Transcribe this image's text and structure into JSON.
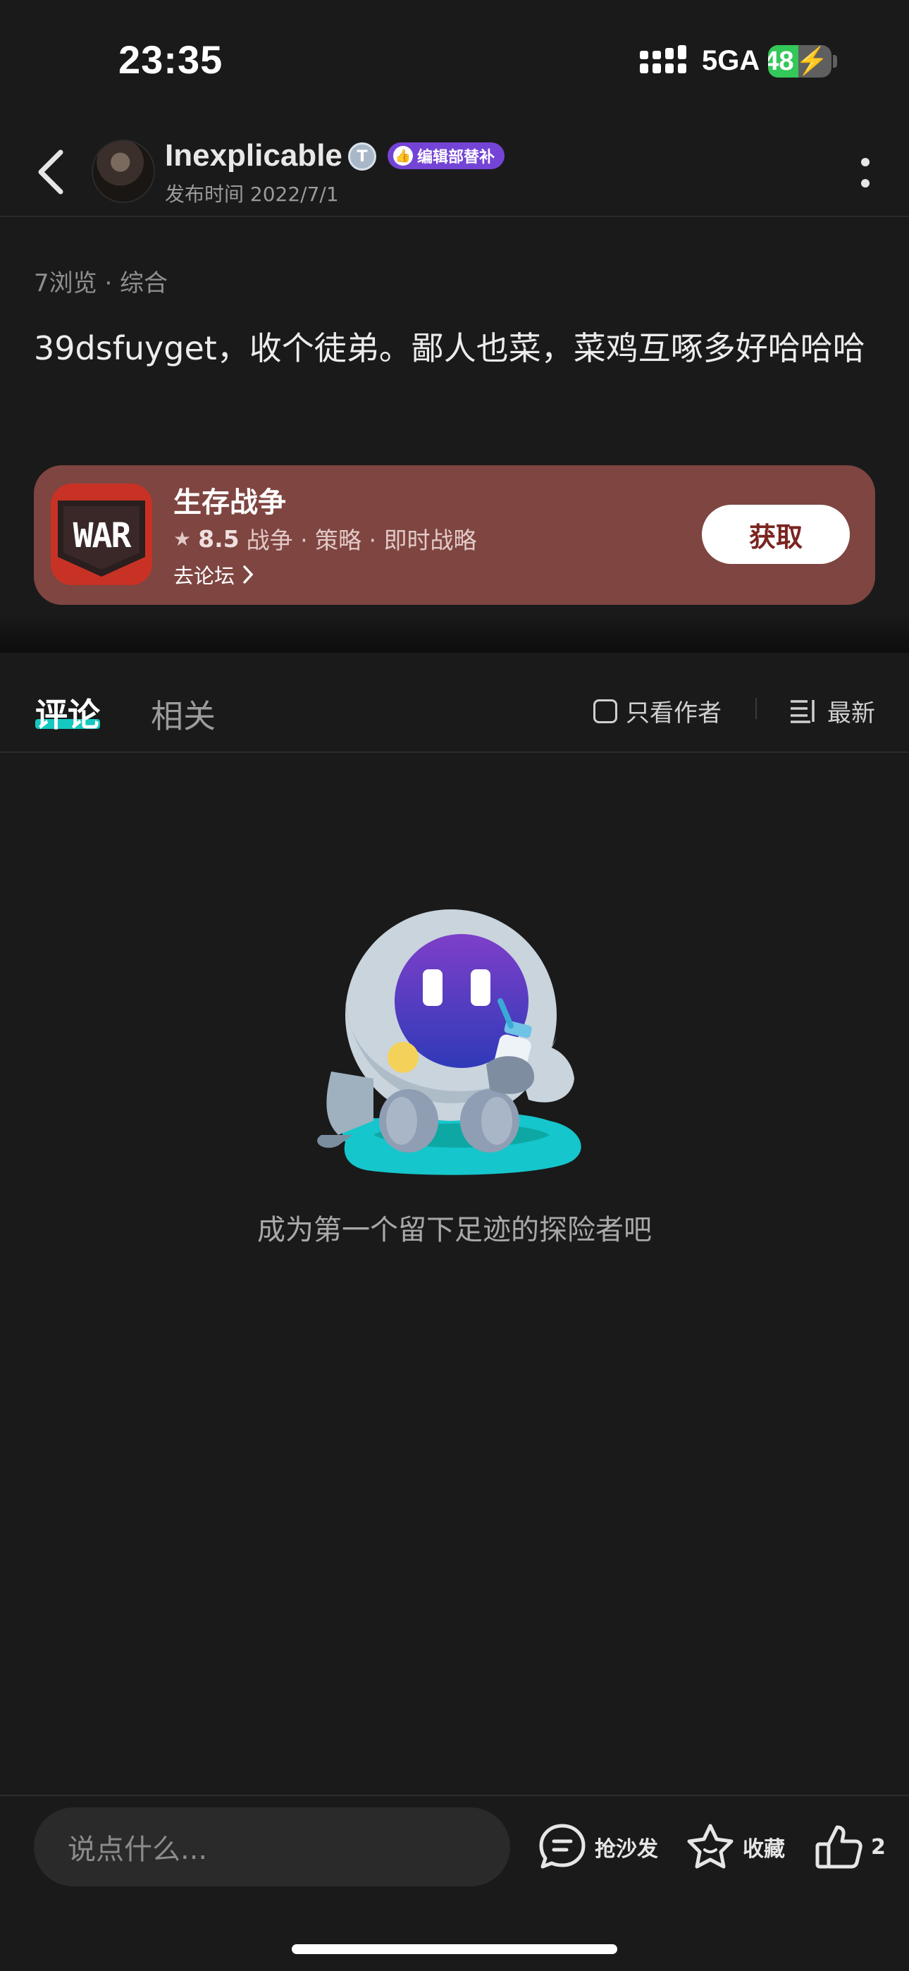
{
  "status_bar": {
    "time": "23:35",
    "network": "5GA",
    "battery": "48",
    "battery_level_pct": 48
  },
  "header": {
    "username": "Inexplicable",
    "level_badge": "T",
    "role_badge": "编辑部替补",
    "publish_time": "发布时间 2022/7/1"
  },
  "post": {
    "meta": "7浏览 · 综合",
    "text": "39dsfuyget，收个徒弟。鄙人也菜，菜鸡互啄多好哈哈哈"
  },
  "game_card": {
    "name": "生存战争",
    "rating": "8.5",
    "tags": "战争 · 策略 · 即时战略",
    "forum_link": "去论坛",
    "get_button": "获取",
    "icon_text": "WAR",
    "bg_color": "#7e4541"
  },
  "tabs": {
    "comments": "评论",
    "related": "相关",
    "author_only": "只看作者",
    "sort": "最新",
    "accent": "#14c8c0"
  },
  "empty_state": {
    "text": "成为第一个留下足迹的探险者吧"
  },
  "bottom_bar": {
    "input_placeholder": "说点什么...",
    "sofa_label": "抢沙发",
    "favorite_label": "收藏",
    "like_count": "2"
  }
}
